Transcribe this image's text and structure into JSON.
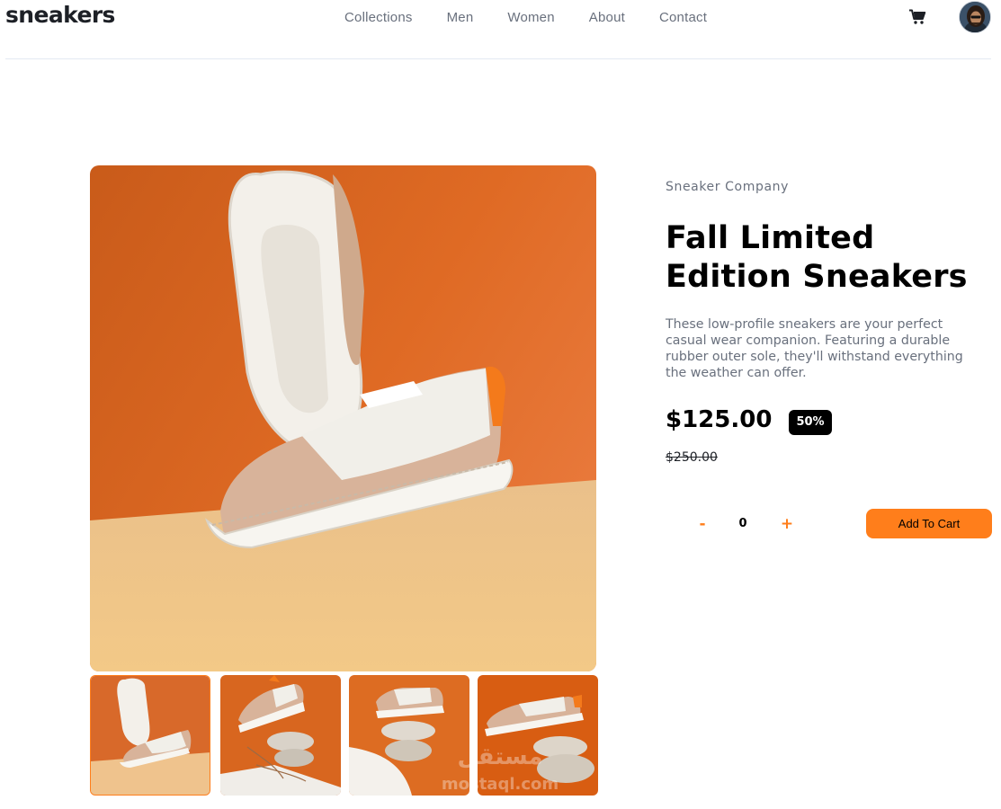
{
  "header": {
    "logo": "sneakers",
    "nav": [
      "Collections",
      "Men",
      "Women",
      "About",
      "Contact"
    ],
    "cart_icon": "cart-icon",
    "avatar_icon": "avatar-icon"
  },
  "product": {
    "company": "Sneaker Company",
    "title": "Fall Limited Edition Sneakers",
    "description": "These low-profile sneakers are your perfect casual wear companion. Featuring a durable rubber outer sole, they'll withstand everything the weather can offer.",
    "price": "$125.00",
    "discount": "50%",
    "original_price": "$250.00",
    "quantity": {
      "minus": "-",
      "value": "0",
      "plus": "+"
    },
    "add_to_cart": "Add To Cart"
  },
  "gallery": {
    "active_index": 0,
    "thumb_count": 4
  },
  "watermark": {
    "arabic": "مستقل",
    "latin": "mostaql.com"
  },
  "colors": {
    "accent": "#ff7e1b",
    "text_dark": "#1d2026",
    "text_grey": "#69707d",
    "image_orange": "#e06a25",
    "image_floor": "#f0c48a"
  }
}
